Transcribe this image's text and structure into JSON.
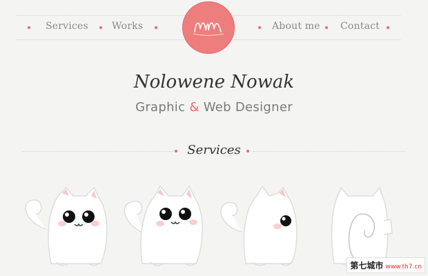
{
  "nav": {
    "items": [
      {
        "label": "Services"
      },
      {
        "label": "Works"
      },
      {
        "label": "About me"
      },
      {
        "label": "Contact"
      }
    ]
  },
  "hero": {
    "name": "Nolowene Nowak",
    "tagline_part1": "Graphic",
    "tagline_amp": "&",
    "tagline_part2": "Web Designer"
  },
  "section": {
    "title": "Services"
  },
  "watermark": {
    "cn": "第七城市",
    "url": "www.th7.cn"
  },
  "colors": {
    "accent": "#ee7d7d",
    "dot": "#ea6a6a",
    "text": "#333333"
  },
  "icons": [
    "logo-mm-icon",
    "cat-front-icon",
    "cat-threequarter-icon",
    "cat-side-icon",
    "cat-back-icon"
  ]
}
